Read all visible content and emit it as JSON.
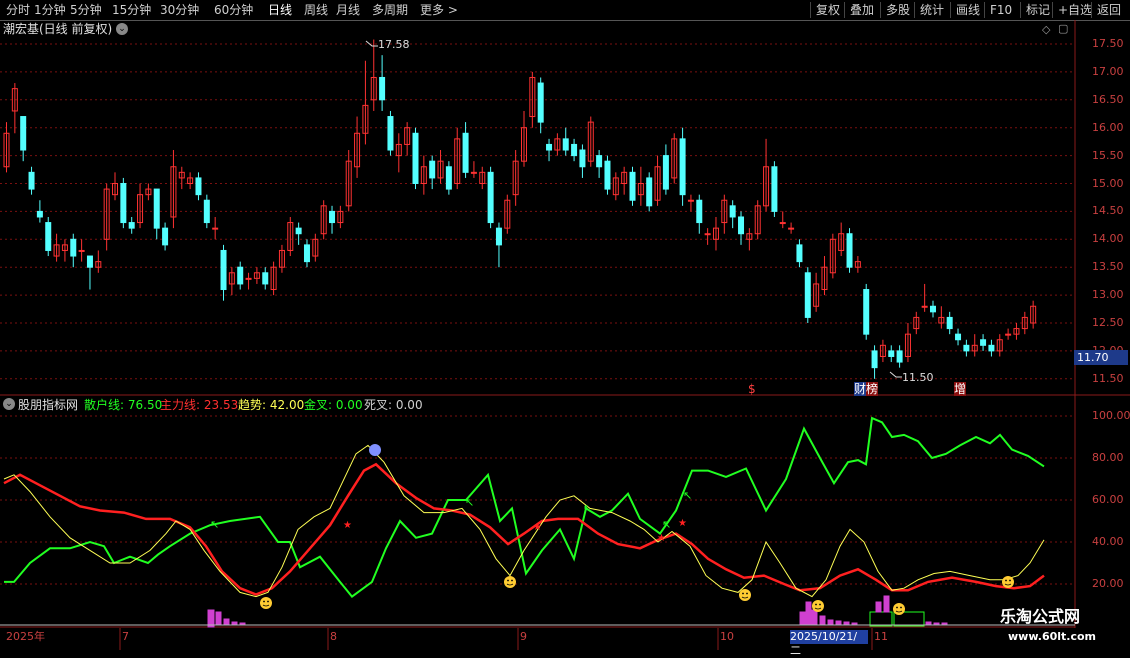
{
  "toolbar": {
    "periods": [
      "分时",
      "1分钟",
      "5分钟",
      "15分钟",
      "30分钟",
      "60分钟",
      "日线",
      "周线",
      "月线",
      "多周期",
      "更多 >"
    ],
    "active_period": "日线",
    "right_items": [
      "复权",
      "叠加",
      "多股",
      "统计",
      "画线",
      "F10",
      "标记",
      "+自选",
      "返回"
    ]
  },
  "main_chart": {
    "title": "潮宏基(日线 前复权)",
    "high_label": "17.58",
    "low_label": "11.50",
    "current_price": "11.70",
    "price_ticks": [
      "17.50",
      "17.00",
      "16.50",
      "16.00",
      "15.50",
      "15.00",
      "14.50",
      "14.00",
      "13.50",
      "13.00",
      "12.50",
      "12.00",
      "11.50"
    ],
    "markers": {
      "s": "$",
      "cai": "财",
      "bang": "榜",
      "zeng": "增"
    },
    "colors": {
      "up": "#ff3232",
      "down": "#54ffff",
      "grid": "#7a1010"
    }
  },
  "indicator": {
    "name": "股朋指标网",
    "items": [
      {
        "label": "散户线: 76.50",
        "color": "#21ff21"
      },
      {
        "label": "主力线: 23.53",
        "color": "#ff3030"
      },
      {
        "label": "趋势: 42.00",
        "color": "#ffff55"
      },
      {
        "label": "金叉: 0.00",
        "color": "#21ff21"
      },
      {
        "label": "死叉: 0.00",
        "color": "#d0d0d0"
      }
    ],
    "ticks": [
      "100.00",
      "80.00",
      "60.00",
      "40.00",
      "20.00"
    ]
  },
  "time_axis": {
    "labels": [
      "2025年",
      "7",
      "8",
      "9",
      "10",
      "11"
    ],
    "cursor_date": "2025/10/21/二"
  },
  "watermark": {
    "line1": "乐淘公式网",
    "line2": "www.60lt.com"
  }
}
